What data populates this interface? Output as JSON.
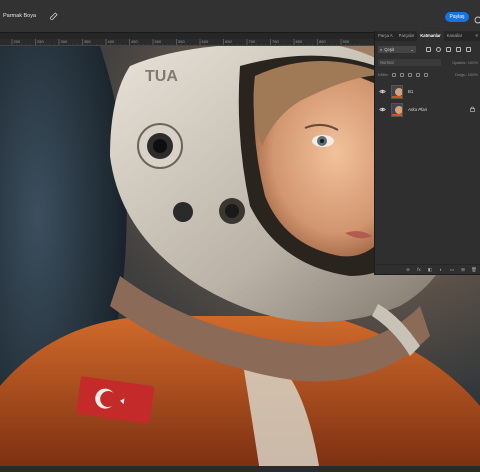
{
  "toolbar": {
    "tool_name": "Parmak Boya",
    "share_label": "Paylaş"
  },
  "ruler": {
    "ticks": [
      "200",
      "250",
      "300",
      "350",
      "400",
      "450",
      "500",
      "550",
      "600",
      "650",
      "700",
      "750",
      "800",
      "850",
      "900"
    ]
  },
  "panel": {
    "tabs": [
      "Parça A",
      "Parçalar",
      "Katmanlar",
      "Kanallar"
    ],
    "active_tab": "Katmanlar",
    "filter": {
      "value": "Çeşit"
    },
    "blend_mode": "Normal",
    "opacity_label": "Opaklık:",
    "opacity_value": "100%",
    "lock_label": "Kilitle:",
    "fill_label": "Dolgu:",
    "fill_value": "100%",
    "layers": [
      {
        "name": "B1",
        "visible": true,
        "locked": false
      },
      {
        "name": "Arka Plan",
        "visible": true,
        "locked": true
      }
    ],
    "footer_icons": [
      "link-icon",
      "fx-icon",
      "mask-icon",
      "adjustment-icon",
      "folder-icon",
      "new-layer-icon",
      "trash-icon"
    ],
    "footer_glyphs": [
      "⊖",
      "fx",
      "◧",
      "◐",
      "▭",
      "⊞",
      "🗑"
    ]
  },
  "colors": {
    "accent": "#1473e6",
    "panel_bg": "#2f2f2f",
    "topbar_bg": "#323232"
  }
}
